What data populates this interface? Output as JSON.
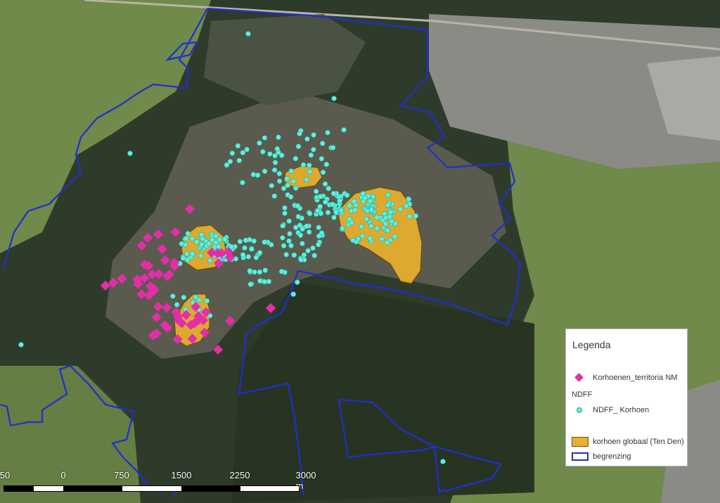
{
  "legend": {
    "title": "Legenda",
    "items": [
      {
        "label": "Korhoenen_territoria NM",
        "symbol": "diamond-marker-icon",
        "color": "#e22ea8"
      },
      {
        "label": "NDFF",
        "symbol": "none"
      },
      {
        "label": "NDFF_ Korhoen",
        "symbol": "dot-marker-icon",
        "color": "#5ff0dc"
      },
      {
        "label": "korhoen globaal (Ten Den)",
        "symbol": "polygon-fill-icon",
        "color": "#e8b12d"
      },
      {
        "label": "begrenzing",
        "symbol": "outline-icon",
        "color": "#1f2fd0"
      }
    ]
  },
  "scalebar": {
    "labels": [
      "50",
      "0",
      "750",
      "1500",
      "2250",
      "3000 m"
    ]
  },
  "colors": {
    "boundary": "#1f2fd0",
    "territory": "#e22ea8",
    "observation": "#5ff0dc",
    "area": "#e8b12d",
    "forest": "#2f3b2a",
    "heath": "#5a5a4e",
    "farmland": "#6f8a4a",
    "urban": "#8b8b86"
  }
}
